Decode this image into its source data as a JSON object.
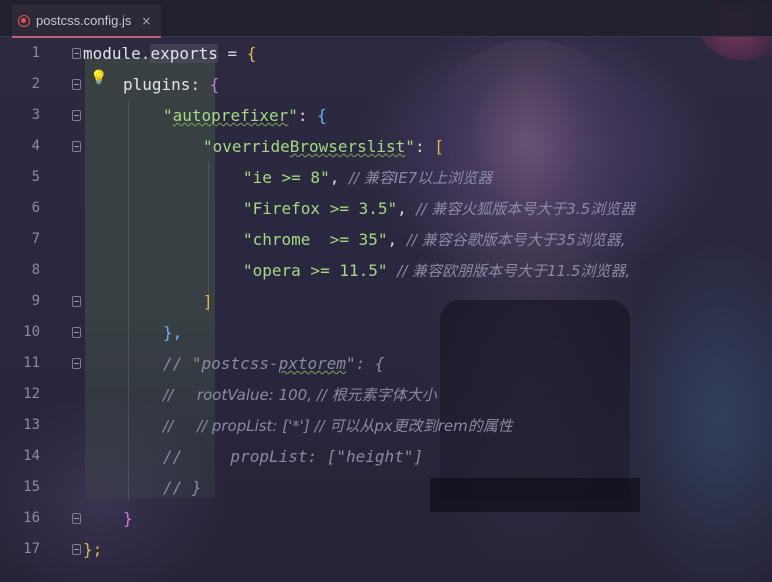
{
  "tab": {
    "label": "postcss.config.js",
    "close": "×"
  },
  "line_numbers": [
    "1",
    "2",
    "3",
    "4",
    "5",
    "6",
    "7",
    "8",
    "9",
    "10",
    "11",
    "12",
    "13",
    "14",
    "15",
    "16",
    "17"
  ],
  "code": {
    "l1_module": "module",
    "l1_dot": ".",
    "l1_exports": "exports",
    "l1_rest": " = ",
    "l1_brace": "{",
    "l2_key": "plugins",
    "l2_colon": ": ",
    "l2_brace": "{",
    "l3_q1": "\"",
    "l3_key": "autoprefixer",
    "l3_q2": "\"",
    "l3_colon": ": ",
    "l3_brace": "{",
    "l4_q1": "\"",
    "l4_key_a": "override",
    "l4_key_b": "Browserslist",
    "l4_q2": "\"",
    "l4_colon": ": ",
    "l4_bracket": "[",
    "l5_str": "\"ie >= 8\"",
    "l5_comma": ", ",
    "l5_cmt": "// 兼容IE7以上浏览器",
    "l6_str": "\"Firefox >= 3.5\"",
    "l6_comma": ", ",
    "l6_cmt": "// 兼容火狐版本号大于3.5浏览器",
    "l7_str": "\"chrome  >= 35\"",
    "l7_comma": ", ",
    "l7_cmt": "// 兼容谷歌版本号大于35浏览器,",
    "l8_str": "\"opera >= 11.5\"",
    "l8_sp": " ",
    "l8_cmt": "// 兼容欧朋版本号大于11.5浏览器,",
    "l9_bracket": "]",
    "l10_brace": "},",
    "l11_cmt_a": "// \"postcss-",
    "l11_cmt_b": "pxtorem",
    "l11_cmt_c": "\": {",
    "l12_cmt": "//     rootValue: 100, // 根元素字体大小",
    "l13_cmt": "//     // propList: ['*'] // 可以从px更改到rem的属性",
    "l14_cmt": "//     propList: [\"height\"]",
    "l15_cmt": "// }",
    "l16_brace": "}",
    "l17_brace": "};"
  }
}
